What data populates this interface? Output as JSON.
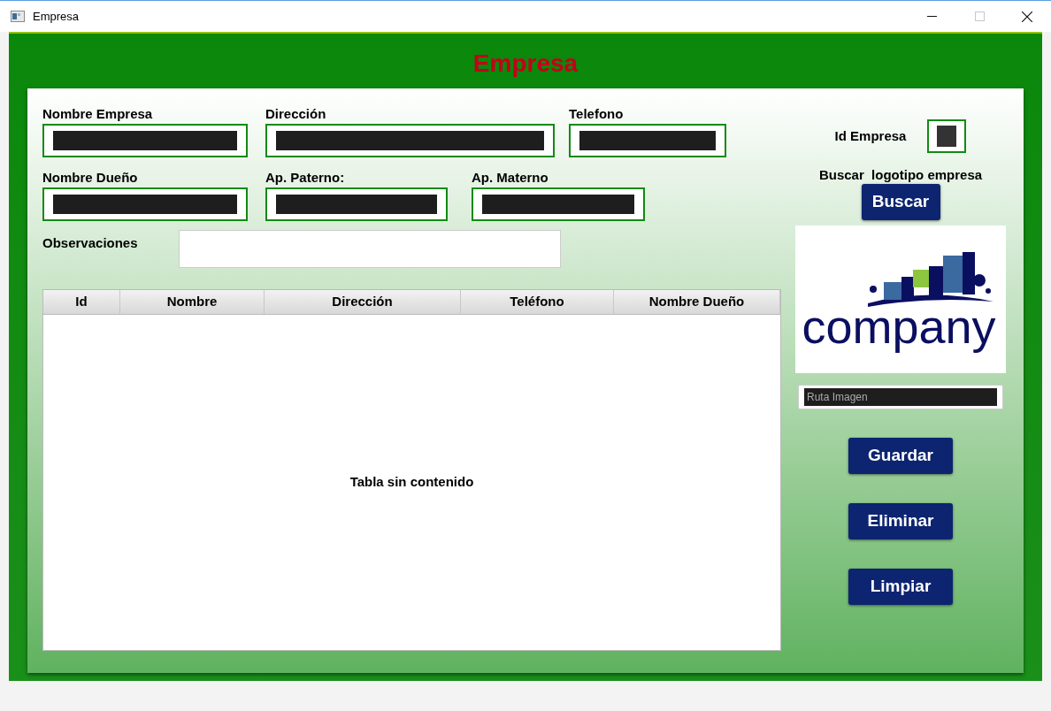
{
  "window": {
    "title": "Empresa"
  },
  "header": {
    "title": "Empresa"
  },
  "form_rows": [
    [
      {
        "label": "Nombre Empresa"
      },
      {
        "label": "Dirección"
      },
      {
        "label": "Telefono"
      }
    ],
    [
      {
        "label": "Nombre Dueño"
      },
      {
        "label": "Ap. Paterno:"
      },
      {
        "label": "Ap. Materno"
      }
    ]
  ],
  "observaciones": {
    "label": "Observaciones"
  },
  "table": {
    "columns": [
      "Id",
      "Nombre",
      "Dirección",
      "Teléfono",
      "Nombre Dueño"
    ],
    "empty_text": "Tabla sin contenido"
  },
  "id_empresa": {
    "label": "Id Empresa"
  },
  "logo_search": {
    "label": "Buscar  logotipo empresa",
    "button": "Buscar"
  },
  "logo": {
    "text": "company"
  },
  "image_path": {
    "placeholder": "Ruta Imagen"
  },
  "actions": [
    "Guardar",
    "Eliminar",
    "Limpiar"
  ]
}
